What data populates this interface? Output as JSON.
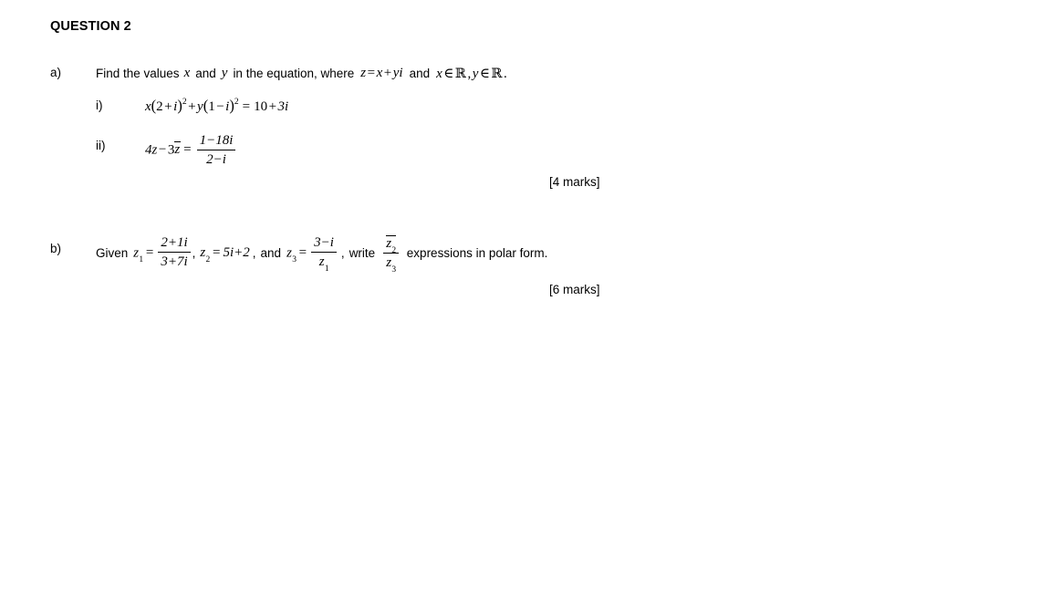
{
  "document": {
    "heading": "QUESTION 2",
    "background_color": "#ffffff",
    "text_color": "#000000"
  },
  "parts": {
    "a": {
      "label": "a)",
      "prompt_before": "Find the values",
      "prompt_var_x": "x",
      "prompt_and_1": "and",
      "prompt_var_y": "y",
      "prompt_after": "in the equation, where",
      "z_def_lhs": "z",
      "z_def_eq": "=",
      "z_def_x": "x",
      "z_def_plus": "+",
      "z_def_yi": "yi",
      "prompt_and_2": "and",
      "domain_x": "x",
      "domain_in_1": "∈",
      "domain_R_1": "ℝ",
      "domain_comma": ",",
      "domain_y": "y",
      "domain_in_2": "∈",
      "domain_R_2": "ℝ",
      "domain_period": ".",
      "marks": "[4 marks]",
      "items": [
        {
          "label": "i)",
          "equation_parts": {
            "x": "x",
            "open_1": "(",
            "two": "2",
            "plus_1": "+",
            "i_1": "i",
            "close_1": ")",
            "exp_1": "2",
            "plus_2": "+",
            "y": "y",
            "open_2": "(",
            "one": "1",
            "minus_1": "−",
            "i_2": "i",
            "close_2": ")",
            "exp_2": "2",
            "equals": "=",
            "ten": "10",
            "plus_3": "+",
            "three_i": "3i"
          },
          "equation_plain": "x(2+i)² + y(1−i)² = 10+3i"
        },
        {
          "label": "ii)",
          "equation_parts": {
            "four_z": "4z",
            "minus": "−",
            "three": "3",
            "z_conj": "z",
            "equals": "=",
            "numerator": "1−18i",
            "denominator": "2−i"
          },
          "equation_plain": "4z − 3z̄ = (1−18i)/(2−i)"
        }
      ]
    },
    "b": {
      "label": "b)",
      "given_word": "Given",
      "z1": {
        "name": "z",
        "sub": "1",
        "eq": "=",
        "numerator": "2+1i",
        "denominator": "3+7i"
      },
      "comma_1": ",",
      "z2": {
        "name": "z",
        "sub": "2",
        "eq": "=",
        "value": "5i+2"
      },
      "comma_2": ",",
      "and_word": "and",
      "z3": {
        "name": "z",
        "sub": "3",
        "eq": "=",
        "numerator": "3−i",
        "denominator_name": "z",
        "denominator_sub": "1"
      },
      "comma_3": ",",
      "write_word": "write",
      "expression": {
        "numerator_name": "z",
        "numerator_sub": "2",
        "denominator_name": "z",
        "denominator_sub": "3"
      },
      "tail_text": "expressions in polar form.",
      "marks": "[6 marks]"
    }
  }
}
